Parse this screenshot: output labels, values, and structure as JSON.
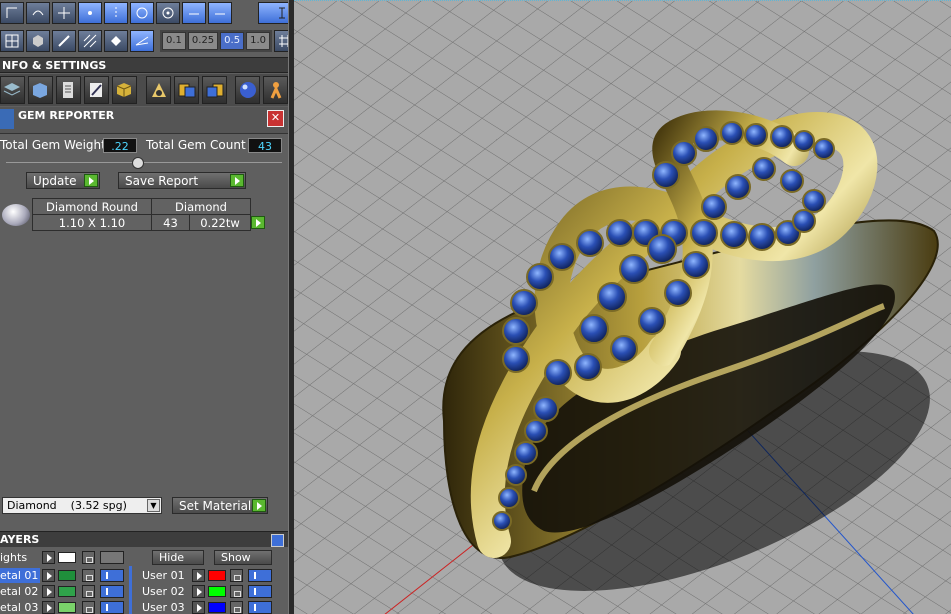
{
  "toolbar": {
    "row1_icons": [
      "rotate-axis-icon",
      "undo-curve-icon",
      "crosshair-icon",
      "point-snap-icon",
      "grid-snap-icon",
      "target-snap-icon",
      "circle-snap-icon",
      "arrow-left-icon",
      "arrow-right-icon",
      "text-cursor-icon"
    ],
    "row2_icons": [
      "grid-view-icon",
      "cube-view-icon",
      "pen-icon",
      "pattern-icon",
      "diamond-icon",
      "perspective-icon"
    ],
    "snap_values": [
      "0.1",
      "0.25",
      "0.5",
      "1.0"
    ],
    "snap_selected": "0.5"
  },
  "info_settings": {
    "title": "NFO & SETTINGS",
    "icons": [
      "layers-stack-icon",
      "box-icon",
      "document-icon",
      "edit-icon",
      "cube-gold-icon",
      "render-scene-icon",
      "copy-left-icon",
      "copy-right-icon",
      "sphere-icon",
      "figure-icon"
    ]
  },
  "gem_reporter": {
    "title": "GEM REPORTER",
    "weight_label": "Total Gem Weight",
    "weight_value": ".22",
    "count_label": "Total Gem Count",
    "count_value": "43",
    "update_label": "Update",
    "save_report_label": "Save Report",
    "row": {
      "shape": "Diamond Round",
      "size": "1.10 X 1.10",
      "material": "Diamond",
      "count": "43",
      "weight": "0.22tw"
    }
  },
  "material": {
    "selected": "Diamond    (3.52 spg)",
    "set_label": "Set Material"
  },
  "layers": {
    "title": "AYERS",
    "lights_label": "ights",
    "hide_label": "Hide",
    "show_label": "Show",
    "left": [
      {
        "label": "etal 01",
        "color": "#1f8f3b"
      },
      {
        "label": "etal 02",
        "color": "#2fa24a"
      },
      {
        "label": "etal 03",
        "color": "#7ad26a"
      }
    ],
    "right": [
      {
        "label": "User 01",
        "color": "#ff0000"
      },
      {
        "label": "User 02",
        "color": "#00ff00"
      },
      {
        "label": "User 03",
        "color": "#0000ff"
      }
    ]
  },
  "colors": {
    "accent_blue": "#3e6fd8",
    "go_green": "#5ab830",
    "value_cyan": "#4ed7ff",
    "viewport_bg": "#a9a9a9",
    "gold": "#c7b04a",
    "gem_blue": "#1f3d8f"
  }
}
